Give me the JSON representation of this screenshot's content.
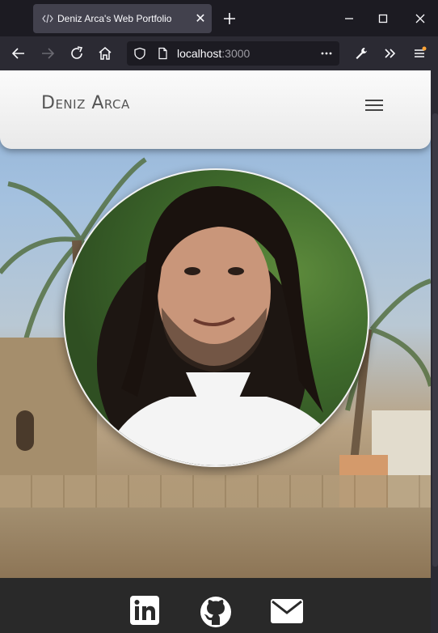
{
  "browser": {
    "tab_title": "Deniz Arca's Web Portfolio",
    "url_host": "localhost",
    "url_port": ":3000"
  },
  "site": {
    "brand": "Deniz Arca"
  },
  "colors": {
    "footer_bg": "#292929",
    "header_bg": "#f5f5f5"
  },
  "social": [
    {
      "icon": "linkedin-icon"
    },
    {
      "icon": "github-icon"
    },
    {
      "icon": "email-icon"
    }
  ]
}
